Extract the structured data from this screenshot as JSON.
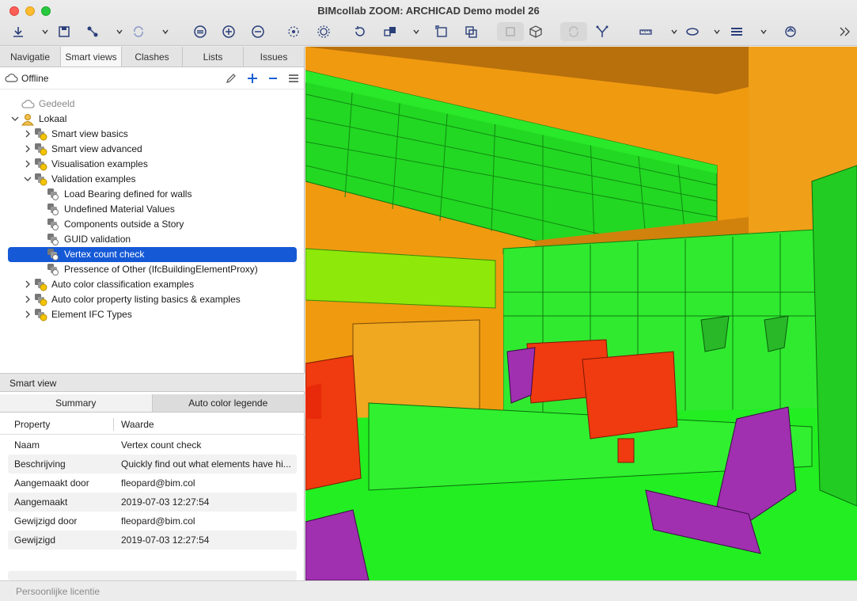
{
  "window": {
    "title": "BIMcollab ZOOM: ARCHICAD Demo model 26"
  },
  "toolbar": {
    "icons": [
      "import-icon",
      "caret-icon",
      "save-icon",
      "connect-icon",
      "caret-icon",
      "sync-icon",
      "caret-icon",
      "zoom-fit-icon",
      "zoom-in-icon",
      "zoom-out-icon",
      "select-point-icon",
      "select-region-icon",
      "reset-view-icon",
      "isolate-icon",
      "caret-icon",
      "clip-box-icon",
      "section-icon",
      "box-view-icon",
      "cube-icon",
      "refresh-view-icon",
      "xray-icon",
      "measure-icon",
      "caret-icon",
      "ellipse-icon",
      "caret-icon",
      "layers-icon",
      "caret-icon",
      "cloud-sync-icon",
      "more-icon"
    ]
  },
  "left_panel": {
    "tabs": [
      "Navigatie",
      "Smart views",
      "Clashes",
      "Lists",
      "Issues"
    ],
    "active_tab": "Smart views",
    "connection_status": "Offline",
    "tree": [
      {
        "label": "Gedeeld",
        "level": 0,
        "expander": "none",
        "icon": "cloud-icon",
        "muted": true
      },
      {
        "label": "Lokaal",
        "level": 0,
        "expander": "open",
        "icon": "user-icon"
      },
      {
        "label": "Smart view basics",
        "level": 1,
        "expander": "closed",
        "icon": "smartview-folder-icon"
      },
      {
        "label": "Smart view advanced",
        "level": 1,
        "expander": "closed",
        "icon": "smartview-folder-icon"
      },
      {
        "label": "Visualisation examples",
        "level": 1,
        "expander": "closed",
        "icon": "smartview-folder-icon"
      },
      {
        "label": "Validation examples",
        "level": 1,
        "expander": "open",
        "icon": "smartview-folder-icon"
      },
      {
        "label": "Load Bearing defined for walls",
        "level": 2,
        "expander": "none",
        "icon": "smartview-icon"
      },
      {
        "label": "Undefined Material Values",
        "level": 2,
        "expander": "none",
        "icon": "smartview-icon"
      },
      {
        "label": "Components outside a Story",
        "level": 2,
        "expander": "none",
        "icon": "smartview-icon"
      },
      {
        "label": "GUID validation",
        "level": 2,
        "expander": "none",
        "icon": "smartview-icon"
      },
      {
        "label": "Vertex count check",
        "level": 2,
        "expander": "none",
        "icon": "smartview-icon",
        "selected": true
      },
      {
        "label": "Pressence of Other (IfcBuildingElementProxy)",
        "level": 2,
        "expander": "none",
        "icon": "smartview-icon"
      },
      {
        "label": "Auto color classification examples",
        "level": 1,
        "expander": "closed",
        "icon": "smartview-folder-icon"
      },
      {
        "label": "Auto color property listing basics & examples",
        "level": 1,
        "expander": "closed",
        "icon": "smartview-folder-icon"
      },
      {
        "label": "Element IFC Types",
        "level": 1,
        "expander": "closed",
        "icon": "smartview-folder-icon"
      }
    ],
    "smart_view_header": "Smart view",
    "subtabs": [
      "Summary",
      "Auto color legende"
    ],
    "active_subtab": "Summary",
    "props_columns": [
      "Property",
      "Waarde"
    ],
    "properties": [
      {
        "key": "Naam",
        "value": "Vertex count check"
      },
      {
        "key": "Beschrijving",
        "value": "Quickly find out what elements have hi..."
      },
      {
        "key": "Aangemaakt door",
        "value": "fleopard@bim.col"
      },
      {
        "key": "Aangemaakt",
        "value": "2019-07-03 12:27:54"
      },
      {
        "key": "Gewijzigd door",
        "value": "fleopard@bim.col"
      },
      {
        "key": "Gewijzigd",
        "value": "2019-07-03 12:27:54"
      }
    ]
  },
  "status_bar": {
    "license": "Persoonlijke licentie"
  },
  "viewport": {
    "name": "3d-model-view",
    "colors": {
      "ok": "#22f022",
      "warn": "#f09a10",
      "high": "#f03a10",
      "critical": "#a030b0"
    }
  }
}
